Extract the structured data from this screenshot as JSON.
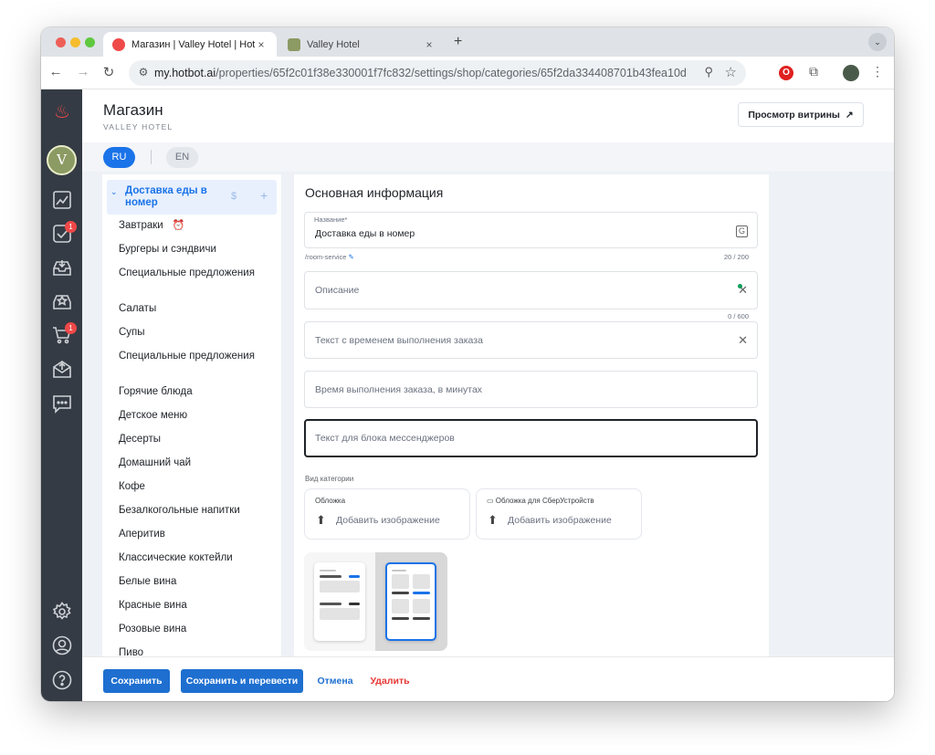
{
  "browser": {
    "tabs": [
      {
        "title": "Магазин | Valley Hotel | Hotbo",
        "active": true
      },
      {
        "title": "Valley Hotel",
        "active": false
      }
    ],
    "new_tab": "+",
    "tab_close": "×",
    "tab_menu": "⌄",
    "url_host": "my.hotbot.ai",
    "url_path": "/properties/65f2c01f38e330001f7fc832/settings/shop/categories/65f2da334408701b43fea10d",
    "nav": {
      "back": "←",
      "forward": "→",
      "reload": "↻"
    },
    "icons": {
      "tune": "⚙",
      "zoom": "⚲",
      "star": "☆",
      "opera": "O",
      "extensions": "⧉",
      "menu": "⋮"
    }
  },
  "rail": {
    "logo": "♨",
    "avatar": "V",
    "badges": {
      "tasks": "1",
      "cart": "1"
    }
  },
  "header": {
    "title": "Магазин",
    "subtitle": "VALLEY HOTEL",
    "preview_button": "Просмотр витрины",
    "preview_arrow": "↗"
  },
  "languages": {
    "ru": "RU",
    "en": "EN"
  },
  "categories": {
    "active": {
      "label": "Доставка еды в номер",
      "chevron": "⌄",
      "dollar": "$",
      "plus": "+"
    },
    "items": [
      "Завтраки",
      "Бургеры и сэндвичи",
      "Специальные предложения",
      "Салаты",
      "Супы",
      "Специальные предложения",
      "Горячие блюда",
      "Детское меню",
      "Десерты",
      "Домашний чай",
      "Кофе",
      "Безалкогольные напитки",
      "Аперитив",
      "Классические коктейли",
      "Белые вина",
      "Красные вина",
      "Розовые вина",
      "Пиво"
    ],
    "alarm_icon": "⏰"
  },
  "form": {
    "section_title": "Основная информация",
    "name": {
      "label": "Название*",
      "value": "Доставка еды в номер",
      "slug": "/room-service",
      "counter": "20 / 200",
      "translate_icon": "G"
    },
    "description": {
      "placeholder": "Описание",
      "counter": "0 / 600",
      "icon": "✕"
    },
    "order_time_text": {
      "placeholder": "Текст с временем выполнения заказа",
      "icon": "✕"
    },
    "order_time_minutes": {
      "placeholder": "Время выполнения заказа, в минутах"
    },
    "messengers_text": {
      "placeholder": "Текст для блока мессенджеров"
    },
    "category_view_label": "Вид категории",
    "cover": {
      "label": "Обложка",
      "button": "Добавить изображение",
      "icon": "⬆"
    },
    "sber_cover": {
      "label": "Обложка для СберУстройств",
      "button": "Добавить изображение",
      "icon": "⬆",
      "device_icon": "▭"
    },
    "selected_layout": "grid"
  },
  "actions": {
    "save": "Сохранить",
    "save_translate": "Сохранить и перевести",
    "cancel": "Отмена",
    "delete": "Удалить"
  },
  "colors": {
    "accent": "#1a73e8",
    "danger": "#e53935",
    "rail": "#353b44"
  }
}
